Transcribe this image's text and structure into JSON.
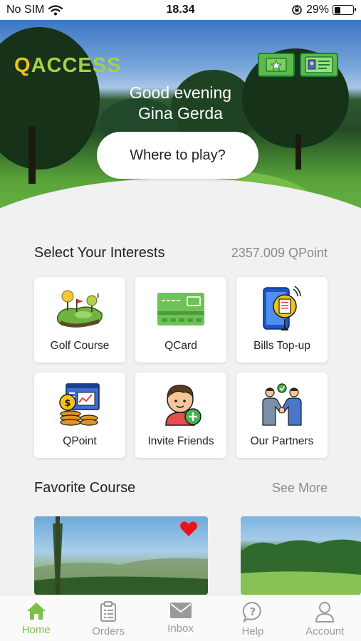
{
  "status_bar": {
    "carrier": "No SIM",
    "time": "18.34",
    "battery": "29%"
  },
  "hero": {
    "logo_q": "Q",
    "logo_rest": "ACCESS",
    "greeting_line1": "Good evening",
    "greeting_line2": "Gina Gerda",
    "search_label": "Where to play?",
    "icons": [
      "ticket-star-icon",
      "member-card-icon"
    ]
  },
  "interests": {
    "title": "Select Your Interests",
    "points": "2357.009 QPoint",
    "items": [
      {
        "label": "Golf Course",
        "icon": "golf-course-icon"
      },
      {
        "label": "QCard",
        "icon": "qcard-icon"
      },
      {
        "label": "Bills Top-up",
        "icon": "bills-topup-icon"
      },
      {
        "label": "QPoint",
        "icon": "qpoint-icon"
      },
      {
        "label": "Invite Friends",
        "icon": "invite-friends-icon"
      },
      {
        "label": "Our Partners",
        "icon": "partners-icon"
      }
    ]
  },
  "favorites": {
    "title": "Favorite Course",
    "see_more": "See More"
  },
  "nav": {
    "items": [
      {
        "label": "Home",
        "icon": "home-icon",
        "active": true
      },
      {
        "label": "Orders",
        "icon": "orders-icon"
      },
      {
        "label": "Inbox",
        "icon": "inbox-icon"
      },
      {
        "label": "Help",
        "icon": "help-icon"
      },
      {
        "label": "Account",
        "icon": "account-icon"
      }
    ]
  },
  "colors": {
    "accent": "#7cc04b",
    "logo_yellow": "#f2c21b",
    "logo_green": "#a3d147",
    "heart": "#e8141c"
  }
}
